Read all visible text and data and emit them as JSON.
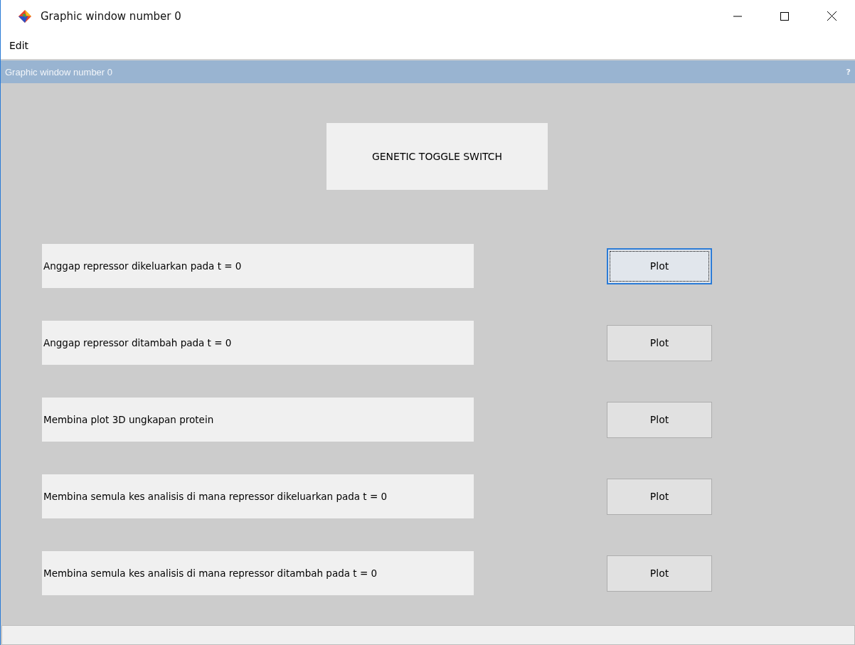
{
  "window": {
    "title": "Graphic window number 0"
  },
  "menu": [
    "Edit"
  ],
  "panel_header": {
    "title": "Graphic window number 0",
    "help": "?"
  },
  "heading": "GENETIC TOGGLE SWITCH",
  "rows": [
    {
      "label": "Anggap repressor dikeluarkan pada t = 0",
      "button": "Plot",
      "focused": true
    },
    {
      "label": "Anggap repressor ditambah pada t = 0",
      "button": "Plot",
      "focused": false
    },
    {
      "label": "Membina plot 3D ungkapan protein",
      "button": "Plot",
      "focused": false
    },
    {
      "label": "Membina semula kes analisis di mana repressor dikeluarkan pada t = 0",
      "button": "Plot",
      "focused": false
    },
    {
      "label": "Membina semula kes analisis di mana repressor ditambah pada t = 0",
      "button": "Plot",
      "focused": false
    }
  ]
}
